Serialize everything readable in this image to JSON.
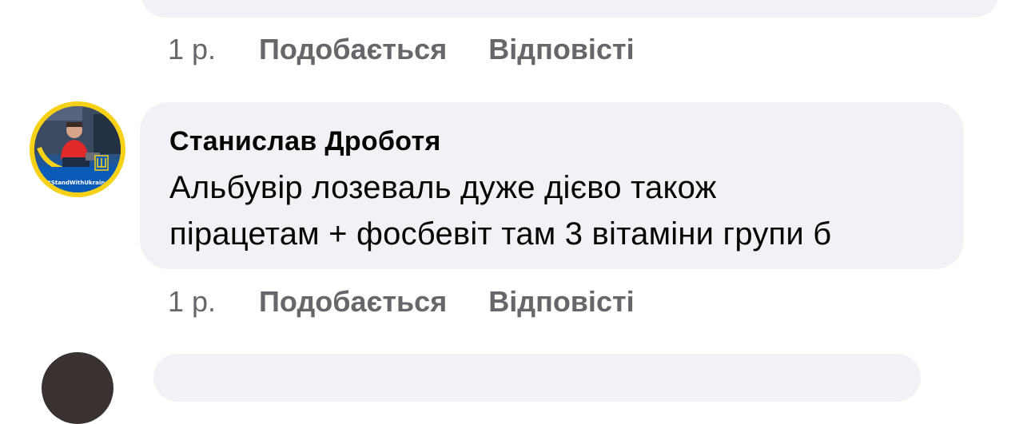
{
  "comment_prev": {
    "time": "1 р.",
    "like_label": "Подобається",
    "reply_label": "Відповісті"
  },
  "comment_main": {
    "author": "Станислав Дроботя",
    "text_lines": [
      "Альбувір лозеваль дуже дієво також",
      "пірацетам + фосбевіт там 3 вітаміни групи б"
    ],
    "avatar_badge_text": "#StandWithUkraine",
    "time": "1 р.",
    "like_label": "Подобається",
    "reply_label": "Відповісті"
  },
  "colors": {
    "bubble_bg": "#f0f2f5",
    "secondary_text": "#65676b",
    "primary_text": "#050505",
    "avatar_frame": "#f7d117",
    "ukraine_blue": "#0a5bb8"
  }
}
